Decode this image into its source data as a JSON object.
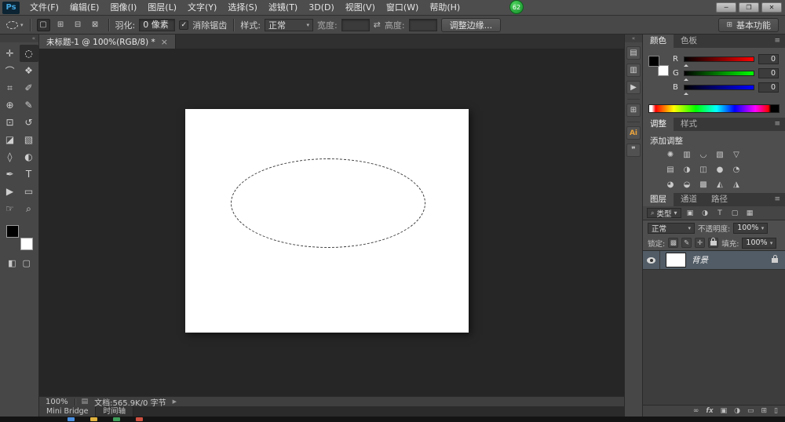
{
  "window": {
    "logo": "Ps",
    "badge": "62",
    "controls": {
      "minimize": "─",
      "restore": "❐",
      "close": "✕"
    }
  },
  "menu": {
    "items": [
      "文件(F)",
      "编辑(E)",
      "图像(I)",
      "图层(L)",
      "文字(Y)",
      "选择(S)",
      "滤镜(T)",
      "3D(D)",
      "视图(V)",
      "窗口(W)",
      "帮助(H)"
    ]
  },
  "options": {
    "feather_label": "羽化:",
    "feather_value": "0 像素",
    "antialias_label": "消除锯齿",
    "style_label": "样式:",
    "style_value": "正常",
    "width_label": "宽度:",
    "height_label": "高度:",
    "refine_edge_label": "调整边缘...",
    "workspace_label": "基本功能"
  },
  "document": {
    "tab_title": "未标题-1 @ 100%(RGB/8) *",
    "close_glyph": "×",
    "zoom": "100%",
    "status": "文档:565.9K/0 字节"
  },
  "bottom_tabs": {
    "mini_bridge": "Mini Bridge",
    "timeline": "时间轴"
  },
  "panels": {
    "color": {
      "tabs": [
        "颜色",
        "色板"
      ],
      "channels": [
        {
          "label": "R",
          "value": "0"
        },
        {
          "label": "G",
          "value": "0"
        },
        {
          "label": "B",
          "value": "0"
        }
      ]
    },
    "adjustments": {
      "tabs": [
        "调整",
        "样式"
      ],
      "title": "添加调整"
    },
    "layers": {
      "tabs": [
        "图层",
        "通道",
        "路径"
      ],
      "filter_label": "类型",
      "blend_mode": "正常",
      "opacity_label": "不透明度:",
      "opacity_value": "100%",
      "lock_label": "锁定:",
      "fill_label": "填充:",
      "fill_value": "100%",
      "background_layer_name": "背景"
    }
  },
  "icons": {
    "dropdown": "▾",
    "swap": "⇄",
    "check": "✓",
    "flyout": "▶",
    "panel_menu": "≡",
    "collapse": "«",
    "workspace_grid": "⊞",
    "status_icon": "▤",
    "quick_mask": "◧",
    "screen_mode": "▢",
    "filter_search": "⌕",
    "modes": [
      "▢",
      "⊞",
      "⊟",
      "⊠"
    ],
    "tools": [
      "✛",
      "◌",
      "⌒",
      "❖",
      "⌗",
      "✐",
      "⊕",
      "✎",
      "⊡",
      "↺",
      "◪",
      "▧",
      "◊",
      "◐",
      "✒",
      "T",
      "▶",
      "▭",
      "☞",
      "⌕"
    ],
    "adjustments": [
      "✺",
      "▥",
      "◡",
      "▧",
      "▽",
      "▤",
      "◑",
      "◫",
      "●",
      "◔",
      "◕",
      "◒",
      "▩",
      "◭",
      "◮"
    ],
    "layer_filters": [
      "▣",
      "◑",
      "T",
      "▢",
      "▦"
    ],
    "locks": [
      "▩",
      "✎",
      "✛"
    ],
    "layer_actions": [
      "∞",
      "fx",
      "▣",
      "◑",
      "▭",
      "⊞",
      "▯"
    ],
    "strip": [
      "▤",
      "▥",
      "▶",
      "⊞",
      "Ai",
      "❞"
    ]
  },
  "colors": {
    "foreground_swatch": "#000000",
    "background_swatch": "#ffffff",
    "badge_green": "#2db84b",
    "selected_layer_row": "#515c66",
    "canvas_background": "#262626",
    "document_background": "#ffffff"
  },
  "taskbar_colors": [
    "#4a90e2",
    "#e0b23e",
    "#3f9d5a",
    "#cf5040"
  ]
}
